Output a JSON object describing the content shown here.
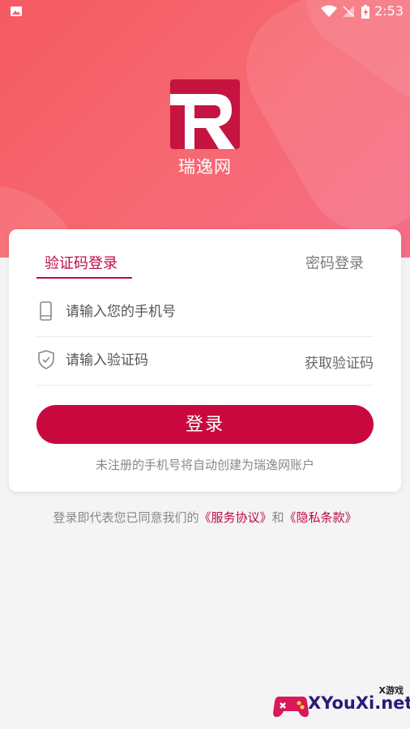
{
  "status_bar": {
    "time": "2:53"
  },
  "app": {
    "name": "瑞逸网"
  },
  "tabs": [
    {
      "label": "验证码登录",
      "active": true
    },
    {
      "label": "密码登录",
      "active": false
    }
  ],
  "form": {
    "phone_placeholder": "请输入您的手机号",
    "code_placeholder": "请输入验证码",
    "get_code_label": "获取验证码",
    "login_label": "登录",
    "auto_register_note": "未注册的手机号将自动创建为瑞逸网账户"
  },
  "agreement": {
    "prefix": "登录即代表您已同意我们的",
    "service_link": "《服务协议》",
    "and": "和",
    "privacy_link": "《隐私条款》"
  },
  "watermark": {
    "text": "XYouXi.net",
    "small": "X游戏"
  },
  "colors": {
    "accent": "#c9083f",
    "hero_start": "#f55a63",
    "hero_end": "#f56d86"
  }
}
